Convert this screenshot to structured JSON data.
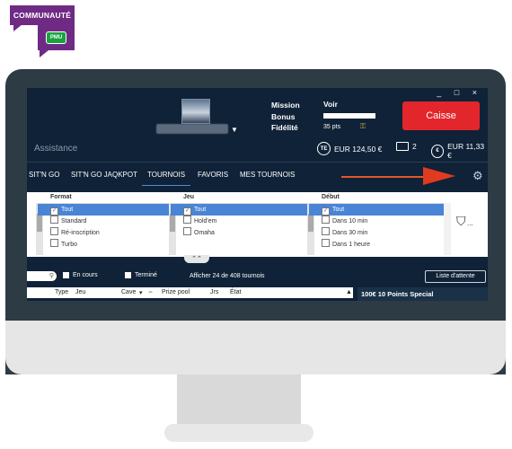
{
  "badge": {
    "title": "COMMUNAUTÉ",
    "logo_text": "PMU"
  },
  "window": {
    "controls": "_ □ ×"
  },
  "header": {
    "mission_lines": [
      "Mission",
      "Bonus",
      "Fidélité"
    ],
    "voir_label": "Voir",
    "points": "35 pts",
    "progress": 1.0,
    "cashier_button": "Caisse",
    "assistance": "Assistance",
    "balances": [
      {
        "icon": "TE",
        "text": "EUR 124,50 €"
      },
      {
        "icon": "ticket-icon",
        "text": "2"
      },
      {
        "icon": "€",
        "text": "EUR 11,33 €"
      }
    ]
  },
  "tabs": [
    "SIT'N GO",
    "SIT'N GO JAQKPOT",
    "TOURNOIS",
    "FAVORIS",
    "MES TOURNOIS"
  ],
  "active_tab": "TOURNOIS",
  "filters": {
    "format": {
      "header": "Format",
      "options": [
        "Tout",
        "Standard",
        "Ré-inscription",
        "Turbo"
      ],
      "selected": "Tout"
    },
    "jeu": {
      "header": "Jeu",
      "options": [
        "Tout",
        "Hold'em",
        "Omaha"
      ],
      "selected": "Tout"
    },
    "debut": {
      "header": "Début",
      "options": [
        "Tout",
        "Dans 10 min",
        "Dans 30 min",
        "Dans 1 heure"
      ],
      "selected": "Tout"
    },
    "more": "..."
  },
  "toolbar": {
    "en_cours": "En cours",
    "termine": "Terminé",
    "afficher": "Afficher 24 de 408 tournois",
    "liste_attente": "Liste d'attente"
  },
  "table_headers": [
    "Type",
    "Jeu",
    "Cave",
    "Prize pool",
    "Jrs",
    "État"
  ],
  "promo": "100€ 10 Points Special",
  "colors": {
    "caisse": "#e3262b",
    "selected_row": "#4a84d4",
    "screen_bg": "#0f2237",
    "arrow": "#e13b1f",
    "badge": "#6f2b84"
  }
}
